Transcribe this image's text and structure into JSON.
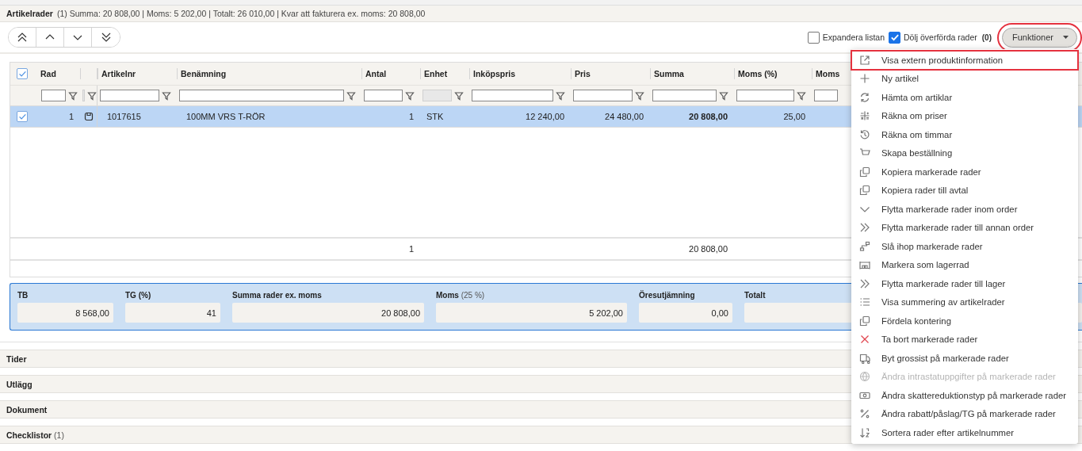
{
  "header": {
    "title": "Artikelrader",
    "summary": "(1) Summa: 20 808,00 | Moms: 5 202,00 | Totalt: 26 010,00 | Kvar att fakturera ex. moms: 20 808,00"
  },
  "nav_buttons": [
    {
      "kind": "first"
    },
    {
      "kind": "up"
    },
    {
      "kind": "down"
    },
    {
      "kind": "last"
    }
  ],
  "options": [
    {
      "label": "Expandera listan",
      "checked": false
    },
    {
      "label": "Dölj överförda rader",
      "checked": true,
      "count": "(0)"
    }
  ],
  "functions_button": {
    "label": "Funktioner",
    "highlighted": true
  },
  "grid": {
    "all_checked": true,
    "columns": [
      {
        "label": "Rad",
        "kind": "number",
        "filter_disabled": false
      },
      {
        "kind": "icon",
        "filter_disabled": true
      },
      {
        "label": "Artikelnr",
        "kind": "text",
        "filter_disabled": false
      },
      {
        "label": "Benämning",
        "kind": "text",
        "filter_disabled": false
      },
      {
        "label": "Antal",
        "kind": "number",
        "filter_disabled": false,
        "total": "1"
      },
      {
        "label": "Enhet",
        "kind": "text",
        "filter_disabled": true
      },
      {
        "label": "Inköpspris",
        "kind": "number",
        "filter_disabled": false
      },
      {
        "label": "Pris",
        "kind": "number",
        "filter_disabled": false
      },
      {
        "label": "Summa",
        "kind": "number",
        "filter_disabled": false,
        "bold": true,
        "total": "20 808,00"
      },
      {
        "label": "Moms (%)",
        "kind": "number",
        "filter_disabled": false
      },
      {
        "label": "Moms",
        "kind": "number",
        "filter_disabled": false
      }
    ],
    "rows": [
      {
        "selected": true,
        "checked": true,
        "cells": [
          "1",
          "",
          "1017615",
          "100MM VRS T-RÖR",
          "1",
          "STK",
          "12 240,00",
          "24 480,00",
          "20 808,00",
          "25,00"
        ]
      }
    ]
  },
  "summary_fields": [
    {
      "label": "TB",
      "value": "8 568,00"
    },
    {
      "label": "TG (%)",
      "value": "41"
    },
    {
      "label": "Summa rader ex. moms",
      "value": "20 808,00"
    },
    {
      "label": "Moms",
      "note": "(25 %)",
      "value": "5 202,00"
    },
    {
      "label": "Öresutjämning",
      "value": "0,00"
    },
    {
      "label": "Totalt"
    }
  ],
  "sections": [
    {
      "title": "Tider"
    },
    {
      "title": "Utlägg"
    },
    {
      "title": "Dokument"
    },
    {
      "title": "Checklistor",
      "count": "(1)"
    }
  ],
  "menu": [
    {
      "kind": "external",
      "label": "Visa extern produktinformation",
      "disabled": false,
      "highlighted": true
    },
    {
      "kind": "plus",
      "label": "Ny artikel",
      "disabled": false,
      "highlighted": false
    },
    {
      "kind": "refresh",
      "label": "Hämta om artiklar",
      "disabled": false,
      "highlighted": false
    },
    {
      "kind": "calc",
      "label": "Räkna om priser",
      "disabled": false,
      "highlighted": false
    },
    {
      "kind": "history",
      "label": "Räkna om timmar",
      "disabled": false,
      "highlighted": false
    },
    {
      "kind": "cart",
      "label": "Skapa beställning",
      "disabled": false,
      "highlighted": false
    },
    {
      "kind": "copy",
      "label": "Kopiera markerade rader",
      "disabled": false,
      "highlighted": false
    },
    {
      "kind": "copy",
      "label": "Kopiera rader till avtal",
      "disabled": false,
      "highlighted": false
    },
    {
      "kind": "chevron",
      "label": "Flytta markerade rader inom order",
      "disabled": false,
      "highlighted": false
    },
    {
      "kind": "double",
      "label": "Flytta markerade rader till annan order",
      "disabled": false,
      "highlighted": false
    },
    {
      "kind": "merge",
      "label": "Slå ihop markerade rader",
      "disabled": false,
      "highlighted": false
    },
    {
      "kind": "warehouse",
      "label": "Markera som lagerrad",
      "disabled": false,
      "highlighted": false
    },
    {
      "kind": "double",
      "label": "Flytta markerade rader till lager",
      "disabled": false,
      "highlighted": false
    },
    {
      "kind": "list",
      "label": "Visa summering av artikelrader",
      "disabled": false,
      "highlighted": false
    },
    {
      "kind": "copy",
      "label": "Fördela kontering",
      "disabled": false,
      "highlighted": false
    },
    {
      "kind": "cross",
      "label": "Ta bort markerade rader",
      "disabled": false,
      "highlighted": false
    },
    {
      "kind": "truck",
      "label": "Byt grossist på markerade rader",
      "disabled": false,
      "highlighted": false
    },
    {
      "kind": "globe",
      "label": "Ändra intrastatuppgifter på markerade rader",
      "disabled": true,
      "highlighted": false
    },
    {
      "kind": "money",
      "label": "Ändra skattereduktionstyp på markerade rader",
      "disabled": false,
      "highlighted": false
    },
    {
      "kind": "percent",
      "label": "Ändra rabatt/påslag/TG på markerade rader",
      "disabled": false,
      "highlighted": false
    },
    {
      "kind": "sort",
      "label": "Sortera rader efter artikelnummer",
      "disabled": false,
      "highlighted": false
    }
  ]
}
